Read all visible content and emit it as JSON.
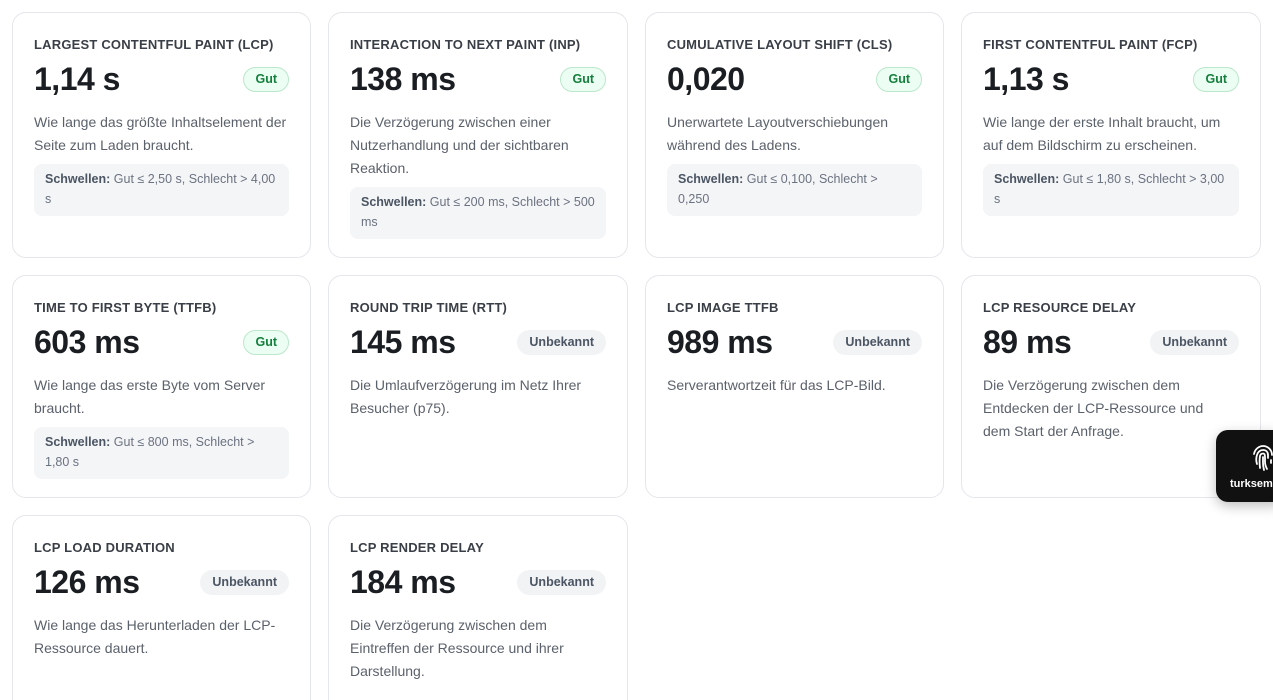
{
  "thresholds_label": "Schwellen:",
  "cards": [
    {
      "title": "LARGEST CONTENTFUL PAINT (LCP)",
      "value": "1,14 s",
      "badge": "Gut",
      "status": "good",
      "description": "Wie lange das größte Inhaltselement der Seite zum Laden braucht.",
      "thresholds": "Gut ≤ 2,50 s, Schlecht > 4,00 s"
    },
    {
      "title": "INTERACTION TO NEXT PAINT (INP)",
      "value": "138 ms",
      "badge": "Gut",
      "status": "good",
      "description": "Die Verzögerung zwischen einer Nutzerhandlung und der sichtbaren Reaktion.",
      "thresholds": "Gut ≤ 200 ms, Schlecht > 500 ms"
    },
    {
      "title": "CUMULATIVE LAYOUT SHIFT (CLS)",
      "value": "0,020",
      "badge": "Gut",
      "status": "good",
      "description": "Unerwartete Layoutverschiebungen während des Ladens.",
      "thresholds": "Gut ≤ 0,100, Schlecht > 0,250"
    },
    {
      "title": "FIRST CONTENTFUL PAINT (FCP)",
      "value": "1,13 s",
      "badge": "Gut",
      "status": "good",
      "description": "Wie lange der erste Inhalt braucht, um auf dem Bildschirm zu erscheinen.",
      "thresholds": "Gut ≤ 1,80 s, Schlecht > 3,00 s"
    },
    {
      "title": "TIME TO FIRST BYTE (TTFB)",
      "value": "603 ms",
      "badge": "Gut",
      "status": "good",
      "description": "Wie lange das erste Byte vom Server braucht.",
      "thresholds": "Gut ≤ 800 ms, Schlecht > 1,80 s"
    },
    {
      "title": "ROUND TRIP TIME (RTT)",
      "value": "145 ms",
      "badge": "Unbekannt",
      "status": "unknown",
      "description": "Die Umlaufverzögerung im Netz Ihrer Besucher (p75)."
    },
    {
      "title": "LCP IMAGE TTFB",
      "value": "989 ms",
      "badge": "Unbekannt",
      "status": "unknown",
      "description": "Serverantwortzeit für das LCP-Bild."
    },
    {
      "title": "LCP RESOURCE DELAY",
      "value": "89 ms",
      "badge": "Unbekannt",
      "status": "unknown",
      "description": "Die Verzögerung zwischen dem Entdecken der LCP-Ressource und dem Start der Anfrage."
    },
    {
      "title": "LCP LOAD DURATION",
      "value": "126 ms",
      "badge": "Unbekannt",
      "status": "unknown",
      "description": "Wie lange das Herunterladen der LCP-Ressource dauert."
    },
    {
      "title": "LCP RENDER DELAY",
      "value": "184 ms",
      "badge": "Unbekannt",
      "status": "unknown",
      "description": "Die Verzögerung zwischen dem Eintreffen der Ressource und ihrer Darstellung."
    }
  ],
  "widget": {
    "label": "turksem",
    "icon": "fingerprint-icon"
  },
  "colors": {
    "good_text": "#15803d",
    "good_bg": "#ecfdf3",
    "unknown_text": "#4b5563",
    "unknown_bg": "#f1f3f5"
  }
}
